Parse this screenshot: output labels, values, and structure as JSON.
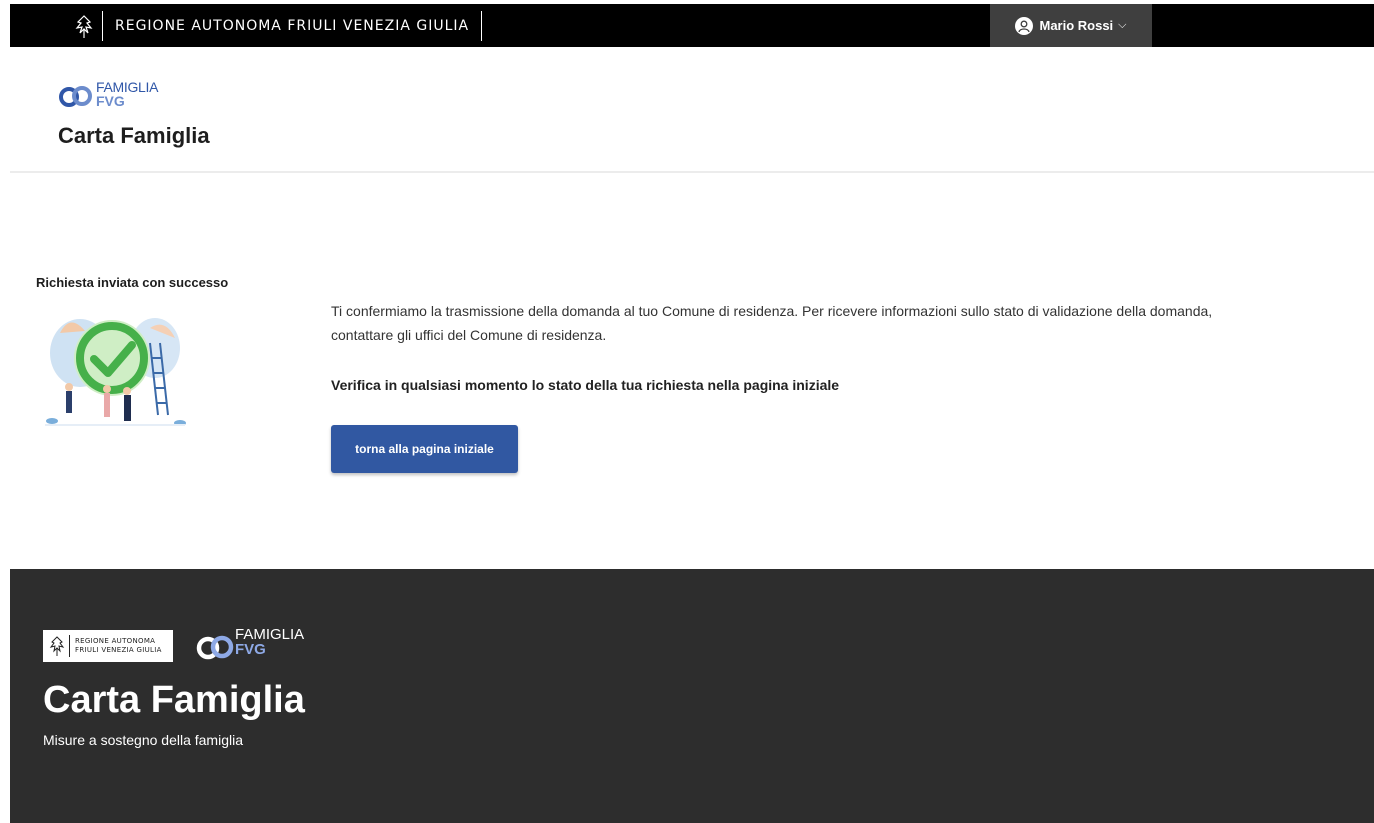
{
  "topbar": {
    "region_name": "REGIONE AUTONOMA FRIULI VENEZIA GIULIA",
    "user_name": "Mario Rossi"
  },
  "header": {
    "logo_word1": "FAMIGLIA",
    "logo_word2": "FVG",
    "title": "Carta Famiglia"
  },
  "main": {
    "success_title": "Richiesta inviata con successo",
    "message": "Ti confermiamo la trasmissione della domanda al tuo Comune di residenza. Per ricevere informazioni sullo stato di validazione della domanda, contattare gli uffici del Comune di residenza.",
    "strong_message": "Verifica in qualsiasi momento lo stato della tua richiesta nella pagina iniziale",
    "home_button": "torna alla pagina iniziale"
  },
  "footer": {
    "region_line1": "REGIONE AUTONOMA",
    "region_line2": "FRIULI VENEZIA GIULIA",
    "logo_word1": "FAMIGLIA",
    "logo_word2": "FVG",
    "title": "Carta Famiglia",
    "subtitle": "Misure a sostegno della famiglia"
  },
  "colors": {
    "primary": "#3158a2",
    "footer_bg": "#2d2d2d",
    "topbar_bg": "#000000"
  }
}
